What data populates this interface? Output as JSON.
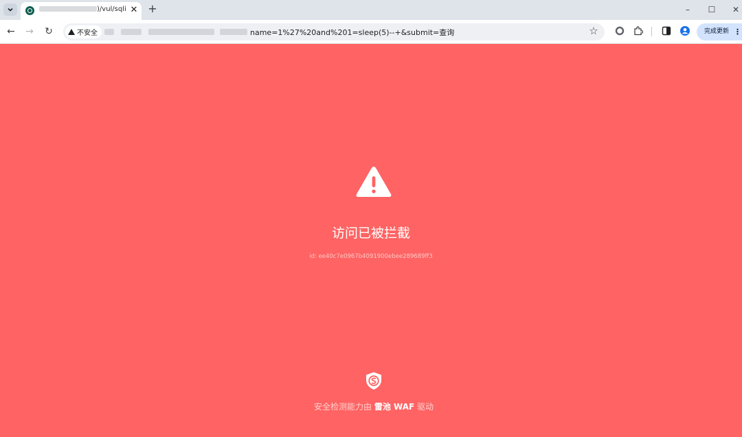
{
  "browser": {
    "tab": {
      "title_suffix": ")/vul/sqli",
      "close_symbol": "✕"
    },
    "new_tab_symbol": "+",
    "window": {
      "minimize_symbol": "–",
      "maximize_symbol": "☐",
      "close_symbol": "✕"
    },
    "toolbar": {
      "back_symbol": "←",
      "forward_symbol": "→",
      "reload_symbol": "↻",
      "security_label": "不安全",
      "url_visible": "name=1%27%20and%201=sleep(5)--+&submit=查询",
      "bookmark_symbol": "☆",
      "update_label": "完成更新",
      "menu_symbol": "⋮"
    }
  },
  "page": {
    "title": "访问已被拦截",
    "request_id": "id: ee40c7e0967b4091900ebee289689ff3",
    "footer": {
      "prefix": "安全检测能力由 ",
      "brand": "雷池 WAF",
      "suffix": " 驱动"
    }
  },
  "colors": {
    "background": "#ff6363",
    "accent_text": "#ffffff",
    "tabstrip": "#dfe3ea",
    "update_button": "#d3e3fd"
  },
  "icons": {
    "warning": "warning-triangle-icon",
    "shield": "safeline-shield-icon",
    "favicon": "site-favicon-icon"
  }
}
